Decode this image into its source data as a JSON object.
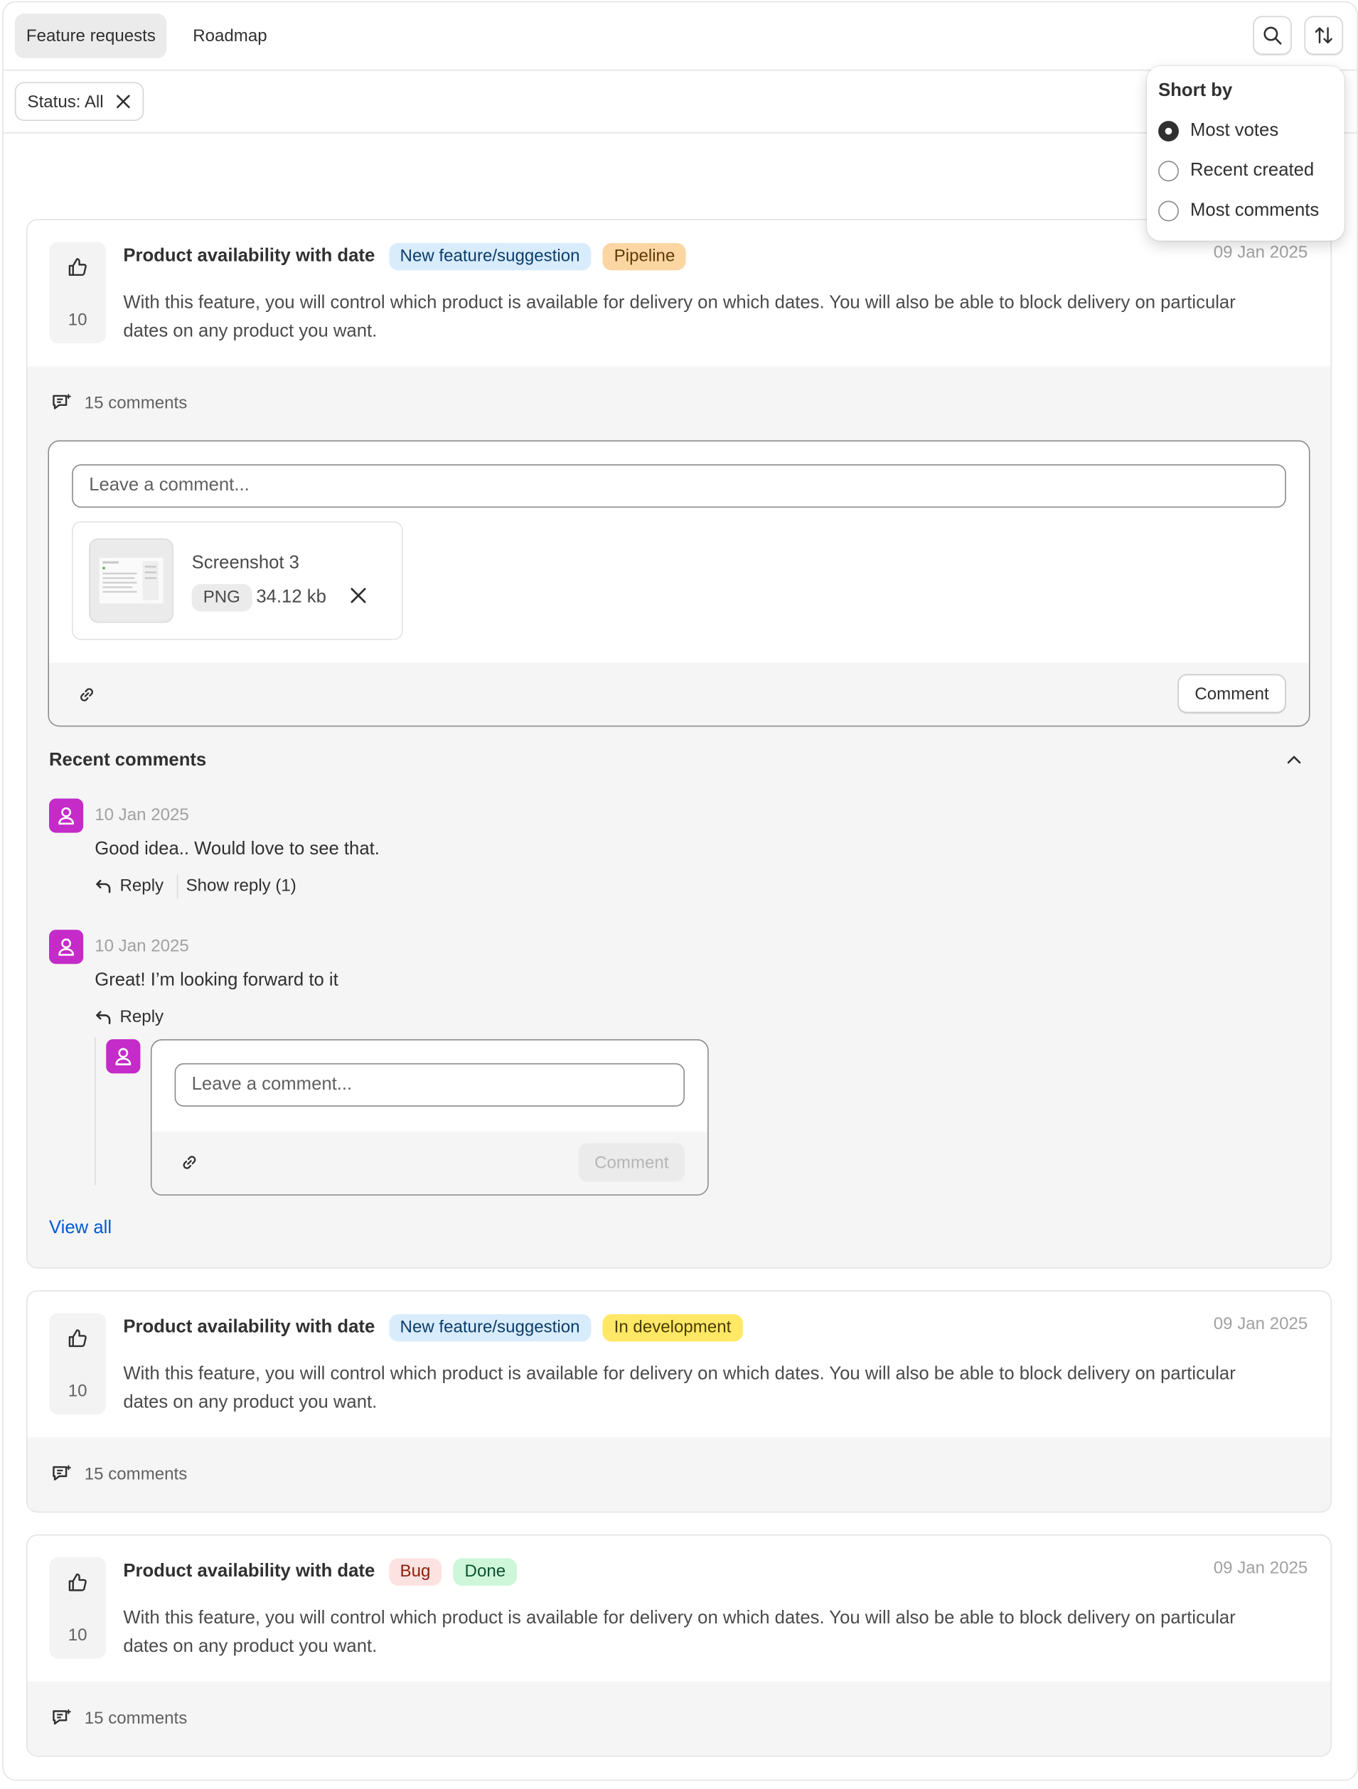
{
  "tabs": [
    {
      "label": "Feature requests",
      "active": true
    },
    {
      "label": "Roadmap",
      "active": false
    }
  ],
  "toolbar": {
    "search_icon": "search-icon",
    "sort_icon": "sort-arrows-icon"
  },
  "filter": {
    "label": "Status: All",
    "remove_icon": "close-icon"
  },
  "sort_menu": {
    "title": "Short by",
    "options": [
      {
        "label": "Most votes",
        "selected": true
      },
      {
        "label": "Recent created",
        "selected": false
      },
      {
        "label": "Most comments",
        "selected": false
      }
    ]
  },
  "requests": [
    {
      "title": "Product availability with date",
      "votes": "10",
      "date": "09 Jan 2025",
      "description": "With this feature, you will control which product is available for delivery on which dates. You will also be able to block delivery on particular dates on any product you want.",
      "badges": [
        {
          "label": "New feature/suggestion",
          "color": "#d9ecfc"
        },
        {
          "label": "Pipeline",
          "color": "#fbd6a3"
        }
      ],
      "comments_count": "15 comments",
      "composer": {
        "placeholder": "Leave a comment...",
        "attachment": {
          "name": "Screenshot 3",
          "type": "PNG",
          "size": "34.12 kb"
        },
        "submit_label": "Comment"
      },
      "recent_title": "Recent comments",
      "recent_comments": [
        {
          "date": "10 Jan 2025",
          "text": "Good idea.. Would love to see that.",
          "reply_label": "Reply",
          "show_reply_label": "Show reply (1)"
        },
        {
          "date": "10 Jan 2025",
          "text": "Great! I’m looking forward to it",
          "reply_label": "Reply"
        }
      ],
      "reply_composer": {
        "placeholder": "Leave a comment...",
        "submit_label": "Comment"
      },
      "view_all_label": "View all"
    },
    {
      "title": "Product availability with date",
      "votes": "10",
      "date": "09 Jan 2025",
      "description": "With this feature, you will control which product is available for delivery on which dates. You will also be able to block delivery on particular dates on any product you want.",
      "badges": [
        {
          "label": "New feature/suggestion",
          "color": "#d9ecfc"
        },
        {
          "label": "In development",
          "color": "#ffe866"
        }
      ],
      "comments_count": "15 comments"
    },
    {
      "title": "Product availability with date",
      "votes": "10",
      "date": "09 Jan 2025",
      "description": "With this feature, you will control which product is available for delivery on which dates. You will also be able to block delivery on particular dates on any product you want.",
      "badges": [
        {
          "label": "Bug",
          "color": "#fde2e2"
        },
        {
          "label": "Done",
          "color": "#cdf7d8"
        }
      ],
      "comments_count": "15 comments"
    }
  ]
}
